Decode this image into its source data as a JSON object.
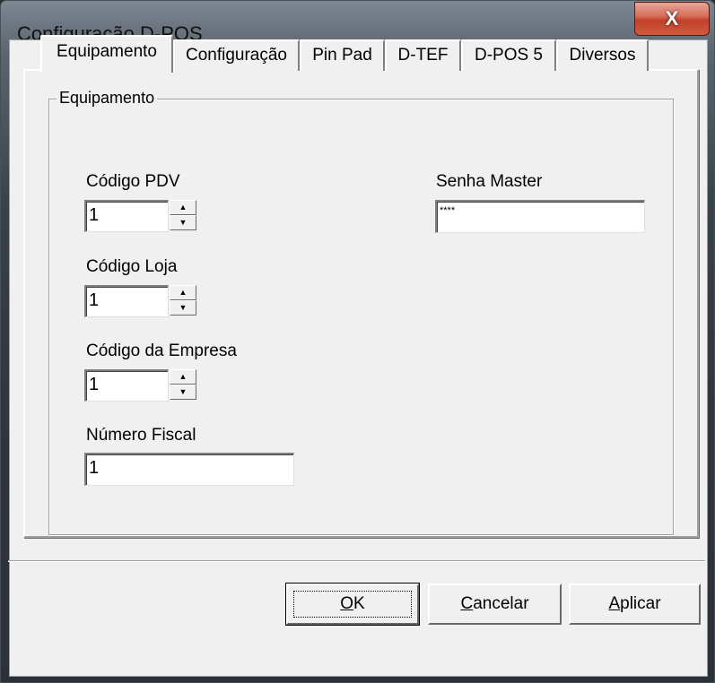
{
  "window": {
    "title": "Configuração D-POS",
    "close_glyph": "X"
  },
  "tabs": [
    {
      "label": "Equipamento"
    },
    {
      "label": "Configuração"
    },
    {
      "label": "Pin Pad"
    },
    {
      "label": "D-TEF"
    },
    {
      "label": "D-POS 5"
    },
    {
      "label": "Diversos"
    }
  ],
  "group": {
    "title": "Equipamento"
  },
  "fields": {
    "codigo_pdv": {
      "label": "Código PDV",
      "value": "1"
    },
    "codigo_loja": {
      "label": "Código Loja",
      "value": "1"
    },
    "codigo_empresa": {
      "label": "Código da Empresa",
      "value": "1"
    },
    "numero_fiscal": {
      "label": "Número Fiscal",
      "value": "1"
    },
    "senha_master": {
      "label": "Senha Master",
      "value": "****"
    }
  },
  "buttons": {
    "ok": {
      "mnemonic": "O",
      "rest": "K"
    },
    "cancel": {
      "mnemonic": "C",
      "rest": "ancelar"
    },
    "apply": {
      "mnemonic": "A",
      "rest": "plicar"
    }
  },
  "icons": {
    "spin_up": "▲",
    "spin_down": "▼"
  }
}
